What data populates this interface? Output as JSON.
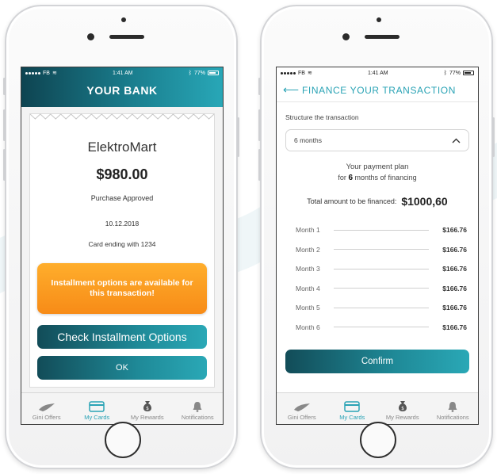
{
  "status": {
    "carrier": "FB",
    "time": "1:41 AM",
    "battery": "77%"
  },
  "bank_screen": {
    "header_title": "YOUR BANK",
    "merchant": "ElektroMart",
    "amount": "$980.00",
    "status_text": "Purchase Approved",
    "date": "10.12.2018",
    "card_text": "Card ending with 1234",
    "installment_banner": "Installment options are available for this transaction!",
    "check_button": "Check Installment Options",
    "ok_button": "OK"
  },
  "finance_screen": {
    "header_title": "FINANCE YOUR TRANSACTION",
    "structure_label": "Structure the transaction",
    "dropdown_value": "6 months",
    "plan_line1": "Your payment plan",
    "plan_prefix": "for",
    "plan_months": "6",
    "plan_suffix": "months of financing",
    "total_label": "Total amount to be financed:",
    "total_amount": "$1000,60",
    "months": [
      {
        "label": "Month 1",
        "amount": "$166.76"
      },
      {
        "label": "Month 2",
        "amount": "$166.76"
      },
      {
        "label": "Month 3",
        "amount": "$166.76"
      },
      {
        "label": "Month 4",
        "amount": "$166.76"
      },
      {
        "label": "Month 5",
        "amount": "$166.76"
      },
      {
        "label": "Month 6",
        "amount": "$166.76"
      }
    ],
    "confirm_button": "Confirm"
  },
  "tabbar": {
    "items": [
      {
        "label": "Gini Offers",
        "icon": "gini-bird-icon"
      },
      {
        "label": "My Cards",
        "icon": "card-icon"
      },
      {
        "label": "My Rewards",
        "icon": "money-bag-icon"
      },
      {
        "label": "Notifications",
        "icon": "bell-icon"
      }
    ]
  },
  "colors": {
    "teal_accent": "#2aa3b5",
    "teal_dark": "#124c58",
    "orange": "#f78b17"
  }
}
